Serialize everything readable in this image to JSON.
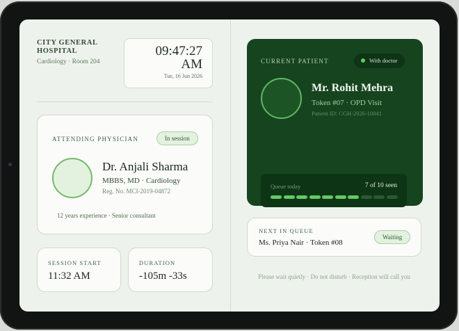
{
  "hospital": {
    "name": "CITY GENERAL HOSPITAL",
    "department": "Cardiology · Room 204"
  },
  "clock": {
    "time": "09:47:27",
    "meridiem": "AM",
    "date": "Tue, 16 Jun 2026"
  },
  "physician": {
    "section_label": "ATTENDING PHYSICIAN",
    "status": "In session",
    "name": "Dr. Anjali Sharma",
    "credentials": "MBBS, MD · Cardiology",
    "registration": "Reg. No. MCI-2019-04872",
    "experience": "12 years experience · Senior consultant"
  },
  "session": {
    "start_label": "SESSION START",
    "start_value": "11:32 AM",
    "duration_label": "DURATION",
    "duration_value": "-105m -33s"
  },
  "current_patient": {
    "section_label": "CURRENT PATIENT",
    "status": "With doctor",
    "name": "Mr. Rohit Mehra",
    "token": "Token #07 · OPD Visit",
    "patient_id": "Patient ID: CGH-2026-10041",
    "queue_label": "Queue today",
    "queue_count": "7 of 10 seen",
    "queue_seen": 7,
    "queue_total": 10
  },
  "next_in_queue": {
    "section_label": "NEXT IN QUEUE",
    "name": "Ms. Priya Nair · Token #08",
    "status": "Waiting"
  },
  "footer": {
    "note": "Please wait quietly · Do not disturb · Reception will call you"
  },
  "colors": {
    "accent_green": "#16441f",
    "status_dot": "#5ad05e",
    "progress_on": "#63c963"
  }
}
